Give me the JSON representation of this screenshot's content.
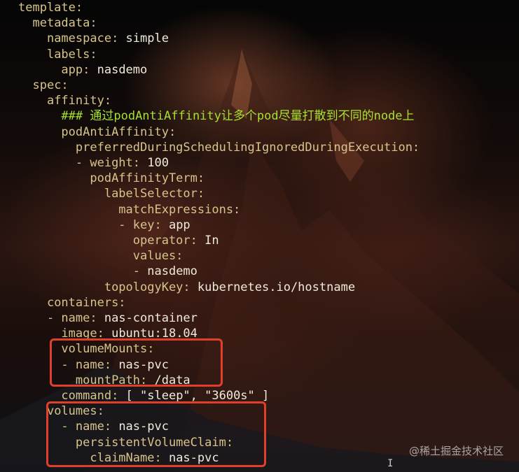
{
  "editor": {
    "lines": [
      {
        "indent": "",
        "key": "template:",
        "value": ""
      },
      {
        "indent": "  ",
        "key": "metadata:",
        "value": ""
      },
      {
        "indent": "    ",
        "key": "namespace:",
        "value": " simple"
      },
      {
        "indent": "    ",
        "key": "labels:",
        "value": ""
      },
      {
        "indent": "      ",
        "key": "app:",
        "value": " nasdemo"
      },
      {
        "indent": "  ",
        "key": "spec:",
        "value": ""
      },
      {
        "indent": "    ",
        "key": "affinity:",
        "value": ""
      },
      {
        "indent": "      ",
        "key": "",
        "value": "",
        "comment": "### 通过podAntiAffinity让多个pod尽量打散到不同的node上"
      },
      {
        "indent": "      ",
        "key": "podAntiAffinity:",
        "value": ""
      },
      {
        "indent": "        ",
        "key": "preferredDuringSchedulingIgnoredDuringExecution:",
        "value": ""
      },
      {
        "indent": "        ",
        "key": "- weight:",
        "value": " 100"
      },
      {
        "indent": "          ",
        "key": "podAffinityTerm:",
        "value": ""
      },
      {
        "indent": "            ",
        "key": "labelSelector:",
        "value": ""
      },
      {
        "indent": "              ",
        "key": "matchExpressions:",
        "value": ""
      },
      {
        "indent": "              ",
        "key": "- key:",
        "value": " app"
      },
      {
        "indent": "                ",
        "key": "operator:",
        "value": " In"
      },
      {
        "indent": "                ",
        "key": "values:",
        "value": ""
      },
      {
        "indent": "                ",
        "key": "-",
        "value": " nasdemo"
      },
      {
        "indent": "            ",
        "key": "topologyKey:",
        "value": " kubernetes.io/hostname"
      },
      {
        "indent": "    ",
        "key": "containers:",
        "value": ""
      },
      {
        "indent": "    ",
        "key": "- name:",
        "value": " nas-container"
      },
      {
        "indent": "      ",
        "key": "image:",
        "value": " ubuntu:18.04"
      },
      {
        "indent": "      ",
        "key": "volumeMounts:",
        "value": ""
      },
      {
        "indent": "      ",
        "key": "- name:",
        "value": " nas-pvc"
      },
      {
        "indent": "        ",
        "key": "mountPath:",
        "value": " /data"
      },
      {
        "indent": "      ",
        "key": "command:",
        "value": " [ \"sleep\", \"3600s\" ]"
      },
      {
        "indent": "    ",
        "key": "volumes:",
        "value": ""
      },
      {
        "indent": "      ",
        "key": "- name:",
        "value": " nas-pvc"
      },
      {
        "indent": "        ",
        "key": "persistentVolumeClaim:",
        "value": ""
      },
      {
        "indent": "          ",
        "key": "claimName:",
        "value": " nas-pvc"
      }
    ]
  },
  "watermark": "@稀土掘金技术社区",
  "colors": {
    "highlight": "#e0402a",
    "comment": "#a6e22e",
    "key": "#d8c48a",
    "value": "#f1eadb"
  },
  "icons": {
    "cursor": "text-cursor-icon"
  }
}
